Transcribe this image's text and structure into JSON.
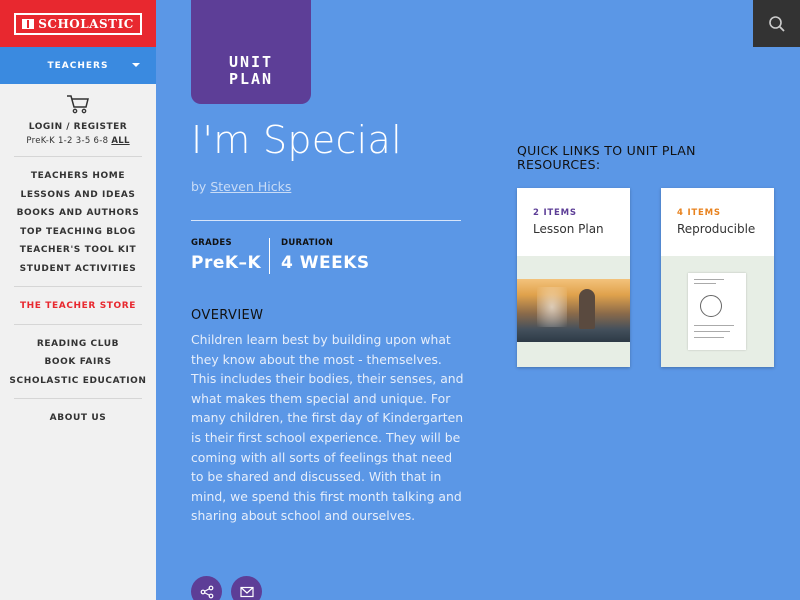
{
  "brand": {
    "logo_text": "SCHOLASTIC"
  },
  "sidebar": {
    "audience_label": "TEACHERS",
    "login_label": "LOGIN / REGISTER",
    "grades": {
      "text": "PreK-K 1-2 3-5 6-8",
      "all_label": "ALL"
    },
    "menu_group_1": [
      "TEACHERS HOME",
      "LESSONS AND IDEAS",
      "BOOKS AND AUTHORS",
      "TOP TEACHING BLOG",
      "TEACHER'S TOOL KIT",
      "STUDENT ACTIVITIES"
    ],
    "store_label": "THE TEACHER STORE",
    "menu_group_2": [
      "READING CLUB",
      "BOOK FAIRS",
      "SCHOLASTIC EDUCATION"
    ],
    "about_label": "ABOUT US"
  },
  "badge": {
    "line1": "UNIT",
    "line2": "PLAN"
  },
  "page": {
    "title": "I'm Special",
    "by": "by",
    "author": "Steven Hicks",
    "grades_label": "GRADES",
    "grades_value": "PreK–K",
    "duration_label": "DURATION",
    "duration_value": "4 WEEKS",
    "overview_heading": "OVERVIEW",
    "overview_text": "Children learn best by building upon what they know about the most - themselves. This includes their bodies, their senses, and what makes them special and unique. For many children, the first day of Kindergarten is their first school experience. They will be coming with all sorts of feelings that need to be shared and discussed. With that in mind, we spend this first month talking and sharing about school and ourselves."
  },
  "quick_links": {
    "title": "QUICK LINKS TO UNIT PLAN RESOURCES:",
    "cards": [
      {
        "count": "2 ITEMS",
        "name": "Lesson Plan",
        "color": "#5d3e97"
      },
      {
        "count": "4 ITEMS",
        "name": "Reproducible",
        "color": "#e8821e"
      }
    ]
  },
  "colors": {
    "brand_red": "#e8282f",
    "page_blue": "#5b97e6",
    "purple": "#5d3e97",
    "nav_blue": "#3a8ae0"
  }
}
